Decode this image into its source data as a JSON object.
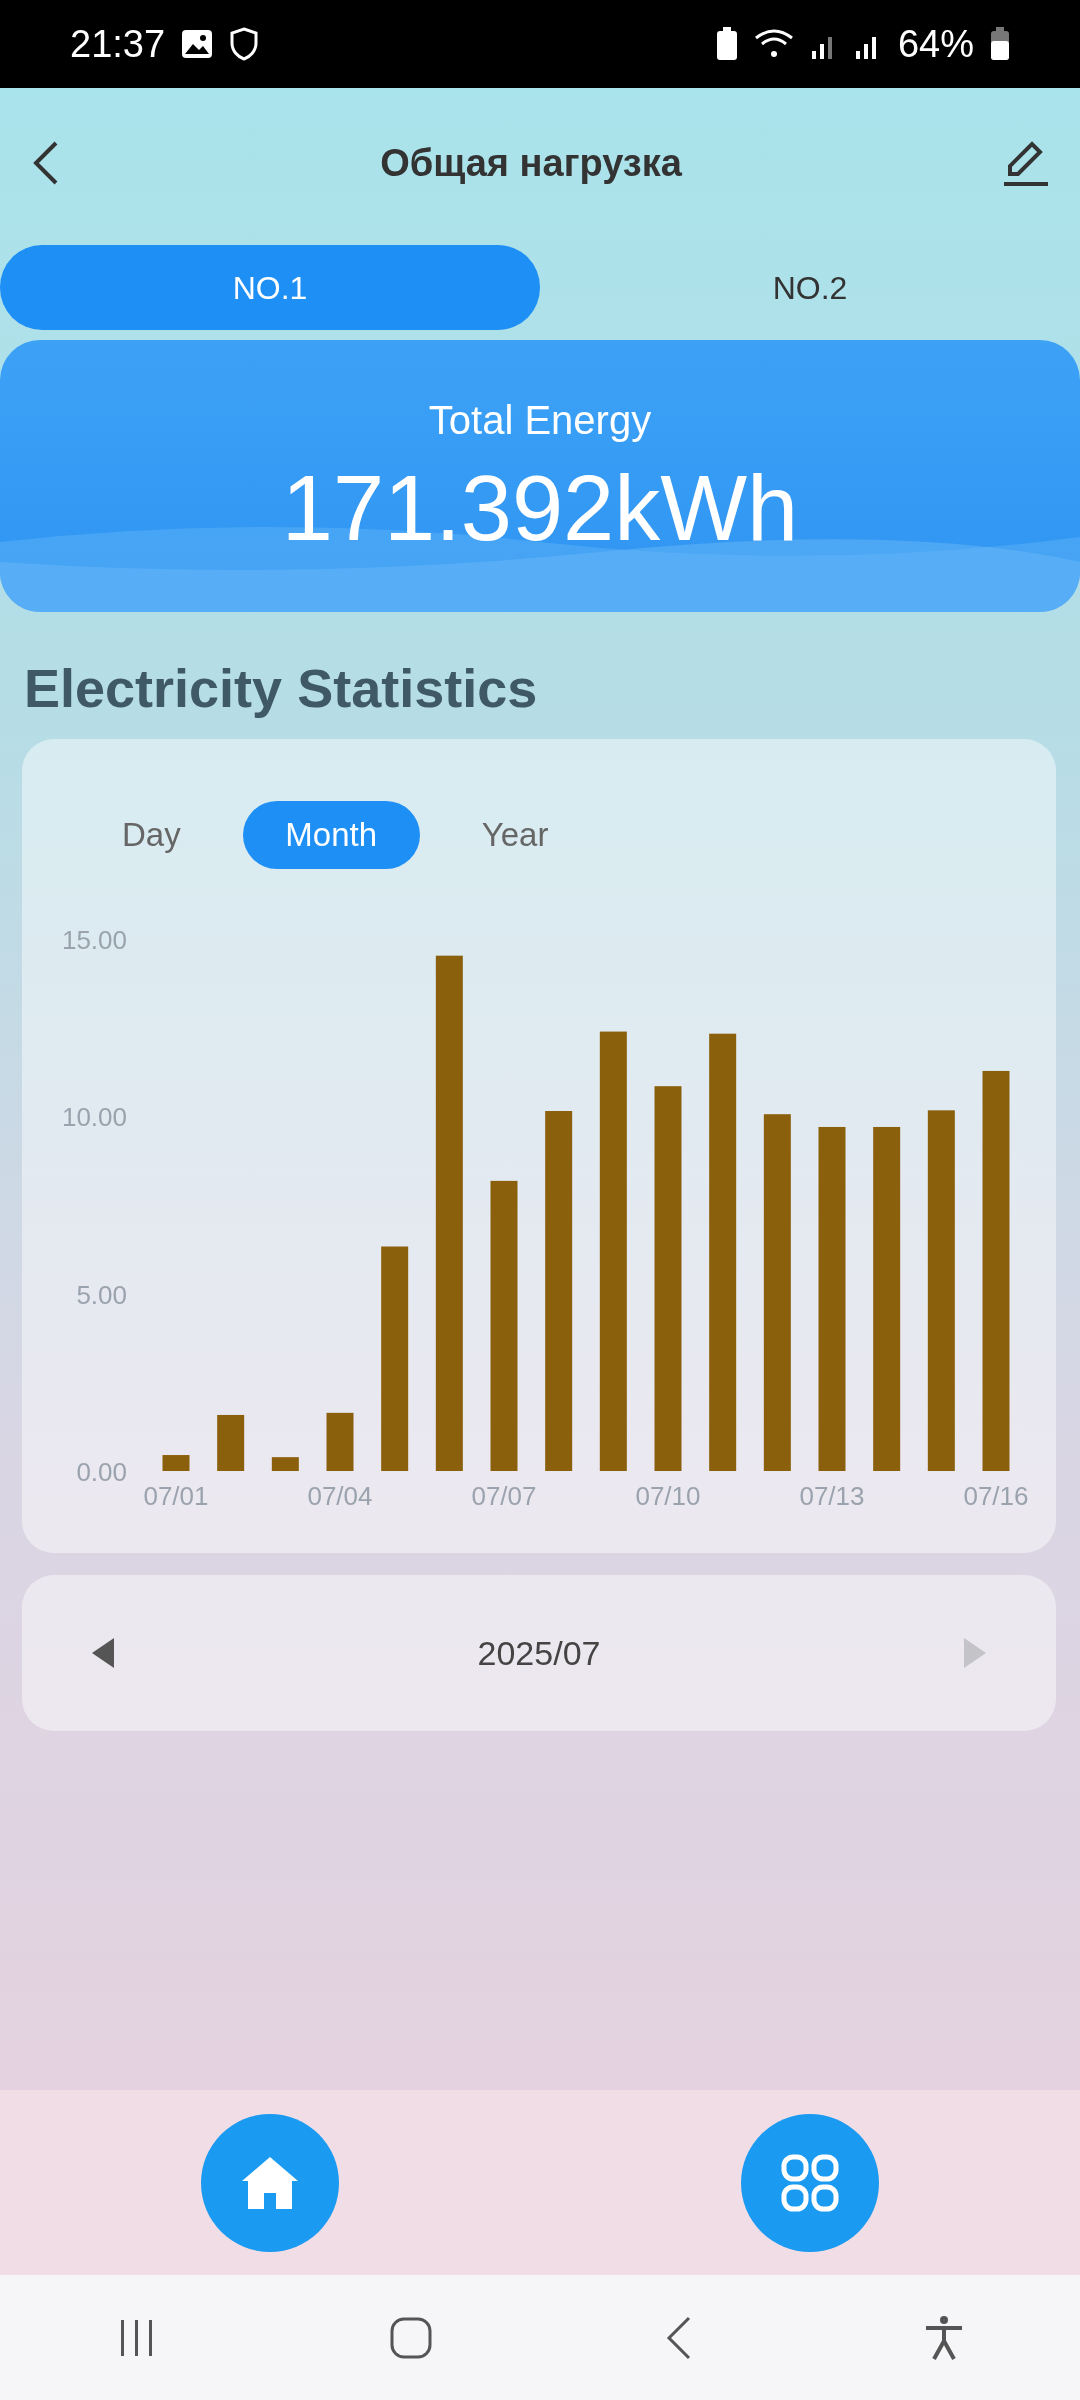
{
  "status_bar": {
    "time": "21:37",
    "battery": "64%"
  },
  "header": {
    "title": "Общая нагрузка"
  },
  "tabs": [
    {
      "label": "NO.1",
      "selected": true
    },
    {
      "label": "NO.2",
      "selected": false
    }
  ],
  "energy": {
    "label": "Total Energy",
    "value": "171.392kWh"
  },
  "section_title": "Electricity Statistics",
  "period_tabs": [
    {
      "label": "Day",
      "selected": false
    },
    {
      "label": "Month",
      "selected": true
    },
    {
      "label": "Year",
      "selected": false
    }
  ],
  "chart_data": {
    "type": "bar",
    "categories": [
      "07/01",
      null,
      null,
      "07/04",
      null,
      null,
      "07/07",
      null,
      null,
      "07/10",
      null,
      null,
      "07/13",
      null,
      null,
      "07/16"
    ],
    "values": [
      0.45,
      1.58,
      0.39,
      1.64,
      6.33,
      14.53,
      8.18,
      10.15,
      12.39,
      10.85,
      12.33,
      10.06,
      9.7,
      9.7,
      10.17,
      11.28
    ],
    "ylim": [
      0,
      15
    ],
    "yticks": [
      {
        "value": 0,
        "label": "0.00"
      },
      {
        "value": 5,
        "label": "5.00"
      },
      {
        "value": 10,
        "label": "10.00"
      },
      {
        "value": 15,
        "label": "15.00"
      }
    ]
  },
  "date_nav": {
    "label": "2025/07",
    "prev": {
      "disabled": false
    },
    "next": {
      "disabled": true
    }
  },
  "bottom_nav": [
    {
      "kind": "home"
    },
    {
      "kind": "apps"
    }
  ]
}
